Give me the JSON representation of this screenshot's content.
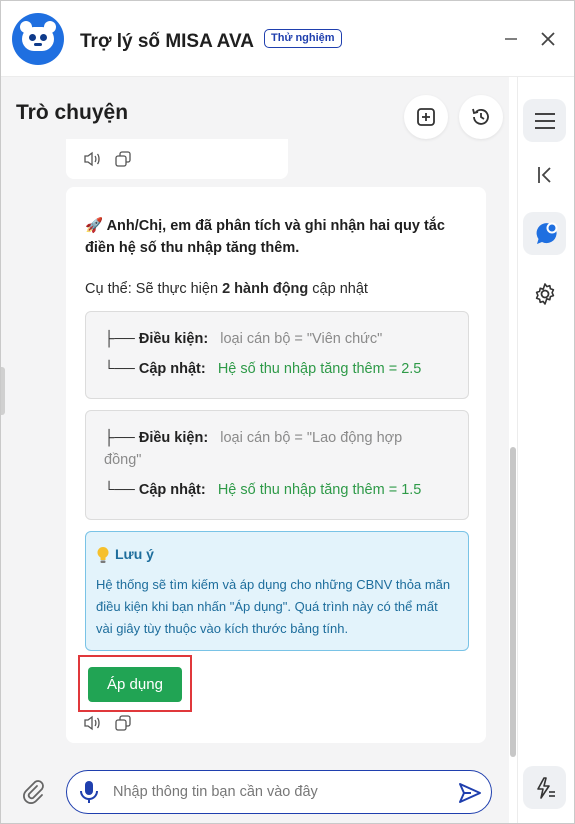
{
  "app": {
    "title": "Trợ lý số MISA AVA",
    "badge": "Thử nghiệm",
    "logo_icon": "panda-robot-logo",
    "brand_color": "#1f3fae"
  },
  "window_controls": {
    "minimize_icon": "minimize-icon",
    "close_icon": "close-icon"
  },
  "chat": {
    "title": "Trò chuyện",
    "new_chat_icon": "new-chat-icon",
    "history_icon": "history-icon"
  },
  "message": {
    "emoji": "🚀",
    "heading": "Anh/Chị, em đã phân tích và ghi nhận hai quy tắc điền hệ số thu nhập tăng thêm.",
    "sub_prefix": "Cụ thể: Sẽ thực hiện ",
    "sub_bold": "2 hành động",
    "sub_suffix": " cập nhật",
    "rules": [
      {
        "condition_tree": "├── ",
        "condition_label": "Điều kiện:",
        "condition_value": "loại cán bộ = \"Viên chức\"",
        "update_tree": "└── ",
        "update_label": "Cập nhật:",
        "update_value": "Hệ số thu nhập tăng thêm = 2.5"
      },
      {
        "condition_tree": "├── ",
        "condition_label": "Điều kiện:",
        "condition_value_line1": "loại cán bộ = \"Lao động hợp",
        "condition_value_line2": "đồng\"",
        "update_tree": "└── ",
        "update_label": "Cập nhật:",
        "update_value": "Hệ số thu nhập tăng thêm = 1.5"
      }
    ],
    "note": {
      "icon": "lightbulb-icon",
      "title": "Lưu ý",
      "text": "Hệ thống sẽ tìm kiếm và áp dụng cho những CBNV thỏa mãn điều kiện khi bạn nhấn \"Áp dụng\". Quá trình này có thể mất vài giây tùy thuộc vào kích thước bảng tính."
    },
    "apply_label": "Áp dụng"
  },
  "input": {
    "placeholder": "Nhập thông tin bạn cần vào đây",
    "value": ""
  },
  "colors": {
    "accent": "#1f3fae",
    "apply_green": "#21a454",
    "update_green": "#2e9a48",
    "note_bg": "#e3f3fb",
    "note_border": "#79c3e6",
    "highlight_red": "#e0383b"
  }
}
